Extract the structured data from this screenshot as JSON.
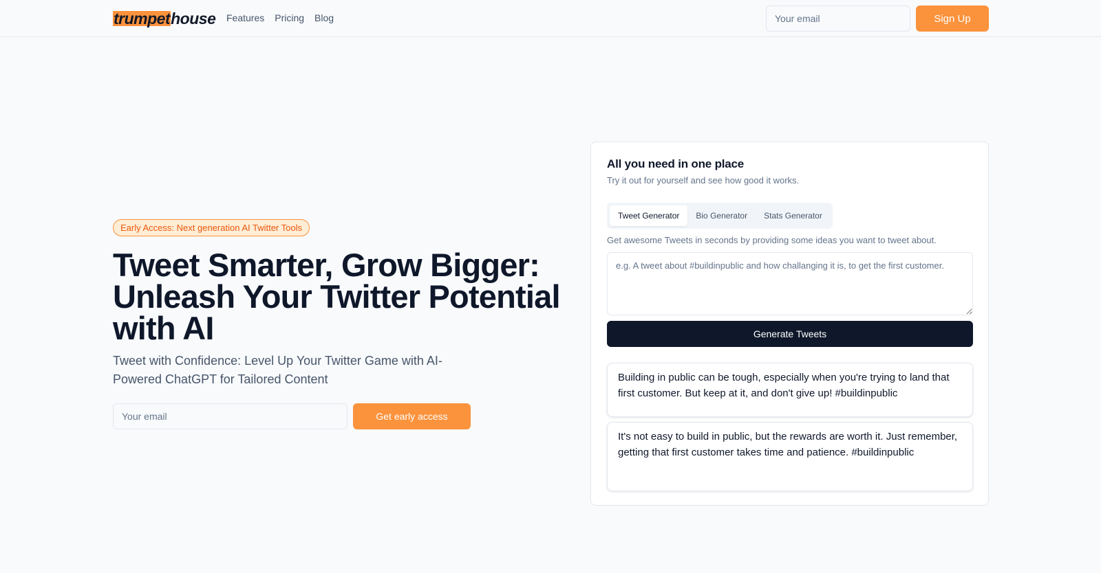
{
  "header": {
    "logo_part1": "trumpet",
    "logo_part2": "house",
    "nav": [
      "Features",
      "Pricing",
      "Blog"
    ],
    "email_placeholder": "Your email",
    "signup_label": "Sign Up"
  },
  "hero": {
    "badge": "Early Access: Next generation AI Twitter Tools",
    "title": "Tweet Smarter, Grow Bigger: Unleash Your Twitter Potential with AI",
    "subtitle": "Tweet with Confidence: Level Up Your Twitter Game with AI-Powered ChatGPT for Tailored Content",
    "email_placeholder": "Your email",
    "cta_label": "Get early access"
  },
  "demo": {
    "title": "All you need in one place",
    "subtitle": "Try it out for yourself and see how good it works.",
    "tabs": [
      "Tweet Generator",
      "Bio Generator",
      "Stats Generator"
    ],
    "active_tab": "Tweet Generator",
    "description": "Get awesome Tweets in seconds by providing some ideas you want to tweet about.",
    "prompt_placeholder": "e.g. A tweet about #buildinpublic and how challanging it is, to get the first customer.",
    "generate_label": "Generate Tweets",
    "results": [
      "Building in public can be tough, especially when you're trying to land that first customer. But keep at it, and don't give up! #buildinpublic",
      "It's not easy to build in public, but the rewards are worth it. Just remember, getting that first customer takes time and patience. #buildinpublic"
    ]
  },
  "colors": {
    "accent": "#fb923c",
    "dark": "#0f172a",
    "background": "#f8fafc"
  }
}
